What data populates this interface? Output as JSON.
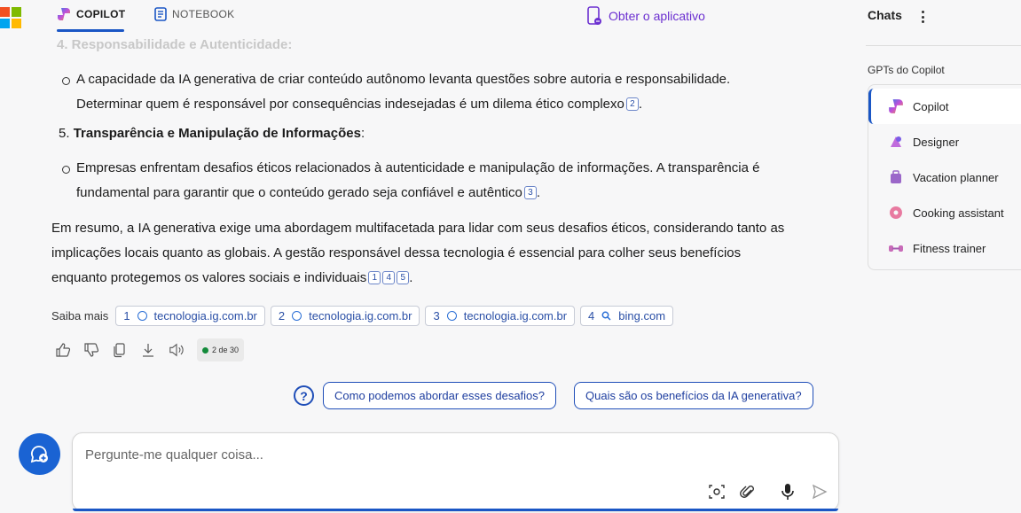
{
  "topbar": {
    "tabs": [
      {
        "label": "COPILOT",
        "active": true
      },
      {
        "label": "NOTEBOOK",
        "active": false
      }
    ],
    "get_app": "Obter o aplicativo"
  },
  "message": {
    "faded_heading": "4. Responsabilidade e Autenticidade:",
    "bullet1": {
      "line1": "A capacidade da IA generativa de criar conteúdo autônomo levanta questões sobre autoria e responsabilidade.",
      "line2": "Determinar quem é responsável por consequências indesejadas é um dilema ético complexo",
      "cite": "2",
      "tail": "."
    },
    "heading5": {
      "number": "5.",
      "bold": "Transparência e Manipulação de Informações",
      "tail": ":"
    },
    "bullet2": {
      "line1": "Empresas enfrentam desafios éticos relacionados à autenticidade e manipulação de informações. A transparência é",
      "line2": "fundamental para garantir que o conteúdo gerado seja confiável e autêntico",
      "cite": "3",
      "tail": "."
    },
    "summary": {
      "line1": "Em resumo, a IA generativa exige uma abordagem multifacetada para lidar com seus desafios éticos, considerando tanto as",
      "line2": "implicações locais quanto as globais. A gestão responsável dessa tecnologia é essencial para colher seus benefícios",
      "line3": "enquanto protegemos os valores sociais e individuais",
      "cites": [
        "1",
        "4",
        "5"
      ],
      "tail": "."
    }
  },
  "sources": {
    "label": "Saiba mais",
    "items": [
      {
        "n": "1",
        "domain": "tecnologia.ig.com.br",
        "icon": "globe-icon"
      },
      {
        "n": "2",
        "domain": "tecnologia.ig.com.br",
        "icon": "globe-icon"
      },
      {
        "n": "3",
        "domain": "tecnologia.ig.com.br",
        "icon": "globe-icon"
      },
      {
        "n": "4",
        "domain": "bing.com",
        "icon": "search-icon"
      }
    ]
  },
  "actions": {
    "counter": "2 de 30"
  },
  "suggestions": [
    "Como podemos abordar esses desafios?",
    "Quais são os benefícios da IA generativa?"
  ],
  "composer": {
    "placeholder": "Pergunte-me qualquer coisa..."
  },
  "sidebar": {
    "title": "Chats",
    "gpts_title": "GPTs do Copilot",
    "gpts": [
      {
        "label": "Copilot",
        "active": true,
        "color": "#2b7de9"
      },
      {
        "label": "Designer",
        "active": false,
        "color": "#b05ad8"
      },
      {
        "label": "Vacation planner",
        "active": false,
        "color": "#9b67c9"
      },
      {
        "label": "Cooking assistant",
        "active": false,
        "color": "#e87aa0"
      },
      {
        "label": "Fitness trainer",
        "active": false,
        "color": "#c86bb8"
      }
    ]
  },
  "colors": {
    "accent": "#1a56c5",
    "brand_purple": "#6b2fd0"
  }
}
